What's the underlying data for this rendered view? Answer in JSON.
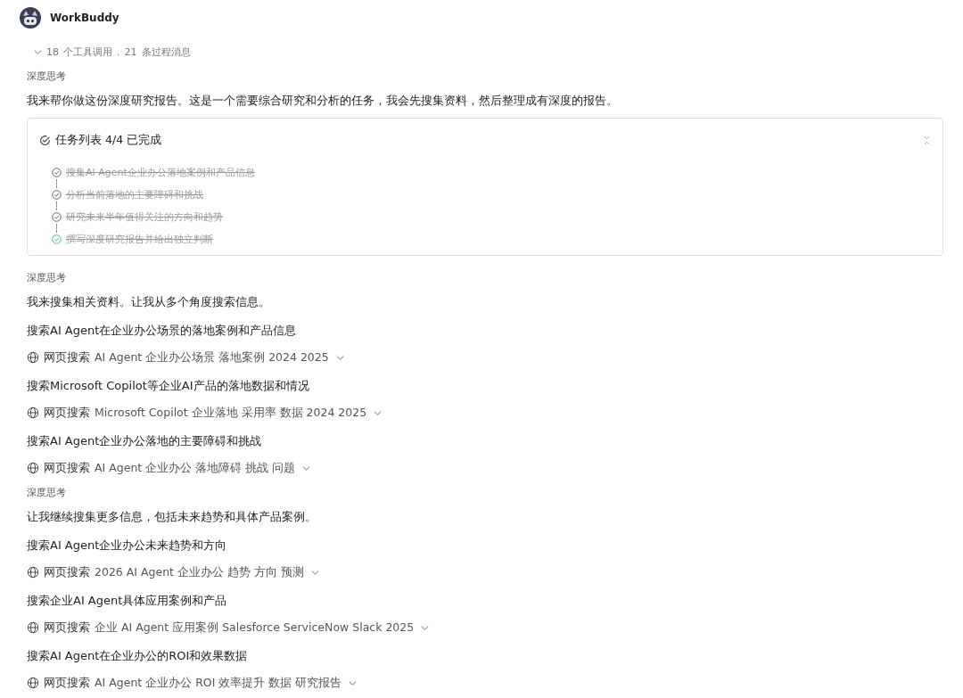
{
  "header": {
    "name": "WorkBuddy"
  },
  "summary": {
    "expanded": false,
    "tool_calls": "18",
    "tool_label": "个工具调用",
    "separator": ",",
    "messages": "21",
    "message_label": "条过程消息"
  },
  "blocks": [
    {
      "kind": "thinking",
      "text": "深度思考"
    },
    {
      "kind": "paragraph",
      "text": "我来帮你做这份深度研究报告。这是一个需要综合研究和分析的任务，我会先搜集资料，然后整理成有深度的报告。"
    },
    {
      "kind": "tasks",
      "title": "任务列表 4/4 已完成",
      "expanded": true,
      "items": [
        {
          "text": "搜集AI Agent企业办公落地案例和产品信息",
          "done": true,
          "current": false
        },
        {
          "text": "分析当前落地的主要障碍和挑战",
          "done": true,
          "current": false
        },
        {
          "text": "研究未来半年值得关注的方向和趋势",
          "done": true,
          "current": false
        },
        {
          "text": "撰写深度研究报告并给出独立判断",
          "done": true,
          "current": true
        }
      ]
    },
    {
      "kind": "thinking",
      "text": "深度思考"
    },
    {
      "kind": "paragraph",
      "text": "我来搜集相关资料。让我从多个角度搜索信息。"
    },
    {
      "kind": "heading",
      "text": "搜索AI Agent在企业办公场景的落地案例和产品信息"
    },
    {
      "kind": "search",
      "label": "网页搜索",
      "query": "AI Agent 企业办公场景 落地案例 2024 2025",
      "expanded": false
    },
    {
      "kind": "heading",
      "text": "搜索Microsoft Copilot等企业AI产品的落地数据和情况"
    },
    {
      "kind": "search",
      "label": "网页搜索",
      "query": "Microsoft Copilot 企业落地 采用率 数据 2024 2025",
      "expanded": false
    },
    {
      "kind": "heading",
      "text": "搜索AI Agent企业办公落地的主要障碍和挑战"
    },
    {
      "kind": "search",
      "label": "网页搜索",
      "query": "AI Agent 企业办公 落地障碍 挑战 问题",
      "expanded": false
    },
    {
      "kind": "thinking",
      "text": "深度思考"
    },
    {
      "kind": "paragraph",
      "text": "让我继续搜集更多信息，包括未来趋势和具体产品案例。"
    },
    {
      "kind": "heading",
      "text": "搜索AI Agent企业办公未来趋势和方向"
    },
    {
      "kind": "search",
      "label": "网页搜索",
      "query": "2026 AI Agent 企业办公 趋势 方向 预测",
      "expanded": false
    },
    {
      "kind": "heading",
      "text": "搜索企业AI Agent具体应用案例和产品"
    },
    {
      "kind": "search",
      "label": "网页搜索",
      "query": "企业 AI Agent 应用案例 Salesforce ServiceNow Slack 2025",
      "expanded": false
    },
    {
      "kind": "heading",
      "text": "搜索AI Agent在企业办公的ROI和效果数据"
    },
    {
      "kind": "search",
      "label": "网页搜索",
      "query": "AI Agent 企业办公 ROI 效率提升 数据 研究报告",
      "expanded": false
    }
  ]
}
